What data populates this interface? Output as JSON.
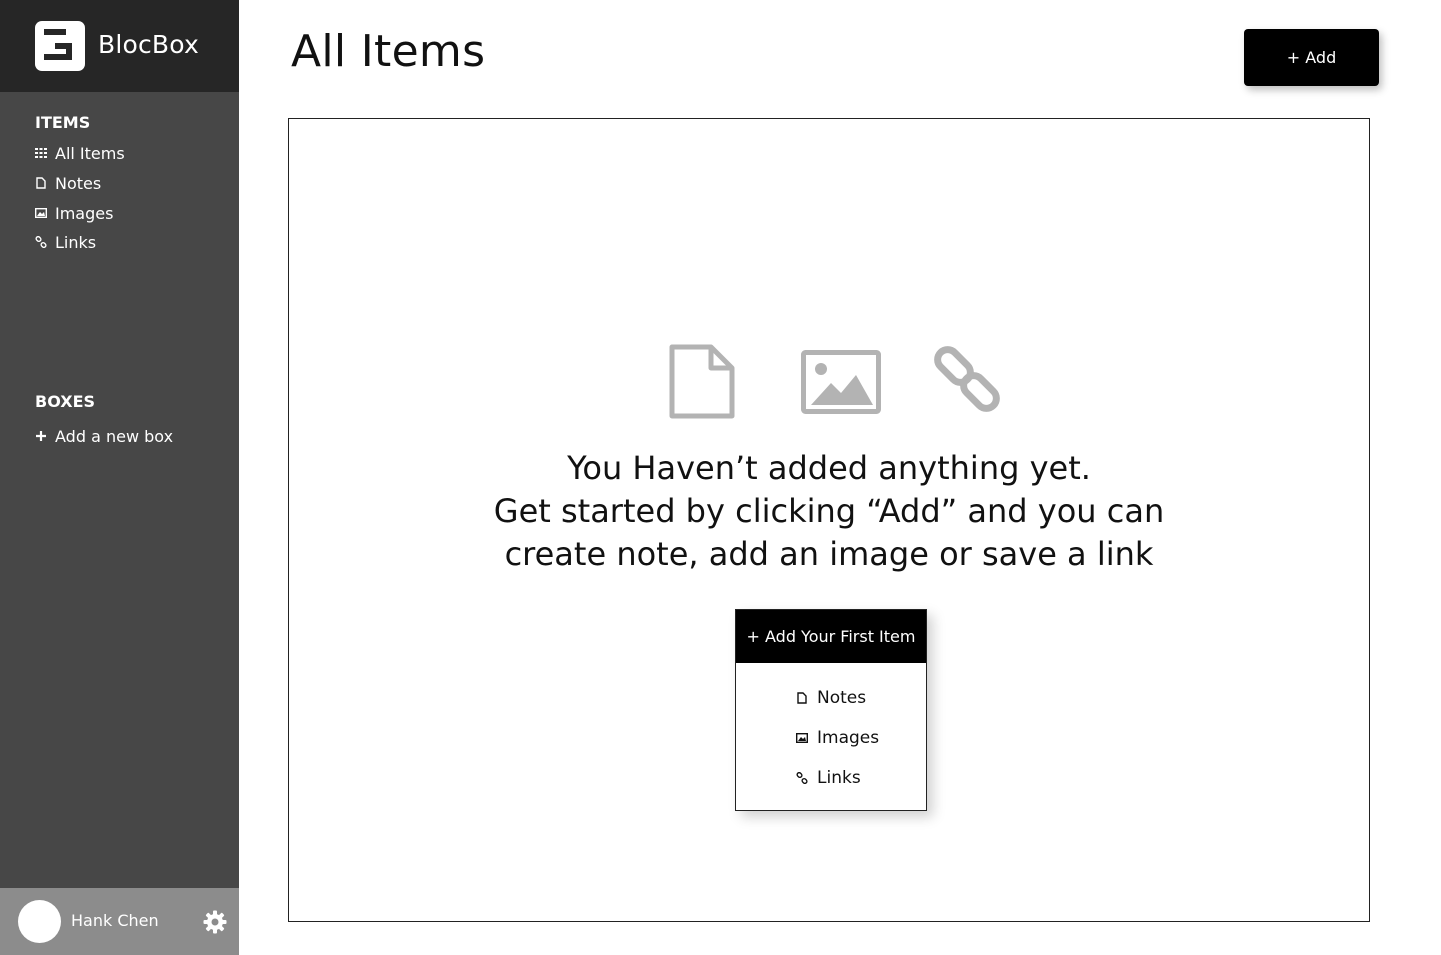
{
  "brand": {
    "name": "BlocBox",
    "logo_icon": "blocbox-logo-icon"
  },
  "sidebar": {
    "items_title": "ITEMS",
    "items": [
      {
        "label": "All Items",
        "icon": "grid-icon"
      },
      {
        "label": "Notes",
        "icon": "note-icon"
      },
      {
        "label": "Images",
        "icon": "image-icon"
      },
      {
        "label": "Links",
        "icon": "link-icon"
      }
    ],
    "boxes_title": "BOXES",
    "add_box_label": "Add a new box",
    "add_box_icon": "plus-icon"
  },
  "user": {
    "name": "Hank Chen",
    "settings_icon": "gear-icon"
  },
  "header": {
    "title": "All Items",
    "add_label": "+ Add"
  },
  "empty_state": {
    "icons": [
      "note-icon",
      "image-icon",
      "link-icon"
    ],
    "lines": [
      "You Haven’t added anything yet.",
      "Get started by clicking “Add” and you can",
      "create note, add an image or save a link"
    ],
    "cta_label": "+ Add Your First Item",
    "menu": [
      {
        "label": "Notes",
        "icon": "note-icon"
      },
      {
        "label": "Images",
        "icon": "image-icon"
      },
      {
        "label": "Links",
        "icon": "link-icon"
      }
    ]
  },
  "colors": {
    "sidebar_bg": "#474747",
    "brand_bg": "#262626",
    "user_bar_bg": "#8c8c8c",
    "button_bg": "#000000",
    "empty_icon": "#b3b3b3"
  }
}
